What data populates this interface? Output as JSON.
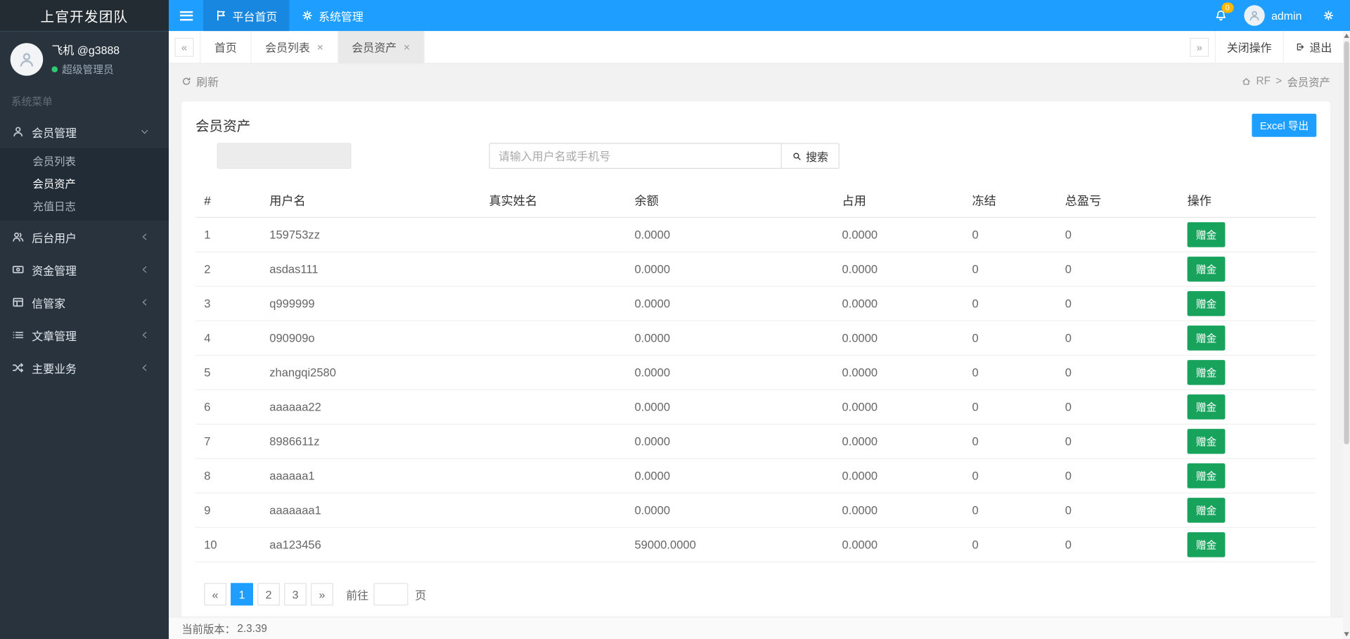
{
  "colors": {
    "navbar": "#1e9fff",
    "sidebar": "#28333e",
    "accent": "#1e9fff",
    "success_button": "#17a35c",
    "badge": "#ffb800"
  },
  "brand": {
    "title": "上官开发团队"
  },
  "topnav": {
    "menu": [
      {
        "label": "平台首页",
        "icon": "flag-icon"
      },
      {
        "label": "系统管理",
        "icon": "gear-icon"
      }
    ],
    "notification_count": "0",
    "username": "admin"
  },
  "sidebar": {
    "profile": {
      "name": "飞机 @g3888",
      "role": "超级管理员"
    },
    "section_label": "系统菜单",
    "menu": [
      {
        "label": "会员管理",
        "icon": "user-icon",
        "expanded": true,
        "children": [
          {
            "label": "会员列表"
          },
          {
            "label": "会员资产",
            "current": true
          },
          {
            "label": "充值日志"
          }
        ]
      },
      {
        "label": "后台用户",
        "icon": "users-icon"
      },
      {
        "label": "资金管理",
        "icon": "money-icon"
      },
      {
        "label": "信管家",
        "icon": "grid-icon"
      },
      {
        "label": "文章管理",
        "icon": "list-icon"
      },
      {
        "label": "主要业务",
        "icon": "shuffle-icon"
      }
    ]
  },
  "tabbar": {
    "scroll_left": "«",
    "scroll_right": "»",
    "close_glyph": "×",
    "tabs": [
      {
        "label": "首页",
        "closable": false
      },
      {
        "label": "会员列表",
        "closable": true
      },
      {
        "label": "会员资产",
        "closable": true,
        "active": true
      }
    ],
    "close_operations": "关闭操作",
    "logout": "退出"
  },
  "toolbar": {
    "refresh": "刷新",
    "breadcrumb": {
      "root": "RF",
      "separator": ">",
      "current": "会员资产"
    }
  },
  "content": {
    "title": "会员资产",
    "export_button": "Excel 导出",
    "search": {
      "placeholder": "请输入用户名或手机号",
      "button": "搜索"
    },
    "table": {
      "headers": [
        "#",
        "用户名",
        "真实姓名",
        "余额",
        "占用",
        "冻结",
        "总盈亏",
        "操作"
      ],
      "action_label": "赠金",
      "rows": [
        {
          "idx": "1",
          "username": "159753zz",
          "realname": "",
          "balance": "0.0000",
          "occupied": "0.0000",
          "frozen": "0",
          "profit": "0"
        },
        {
          "idx": "2",
          "username": "asdas111",
          "realname": "",
          "balance": "0.0000",
          "occupied": "0.0000",
          "frozen": "0",
          "profit": "0"
        },
        {
          "idx": "3",
          "username": "q999999",
          "realname": "",
          "balance": "0.0000",
          "occupied": "0.0000",
          "frozen": "0",
          "profit": "0"
        },
        {
          "idx": "4",
          "username": "090909o",
          "realname": "",
          "balance": "0.0000",
          "occupied": "0.0000",
          "frozen": "0",
          "profit": "0"
        },
        {
          "idx": "5",
          "username": "zhangqi2580",
          "realname": "",
          "balance": "0.0000",
          "occupied": "0.0000",
          "frozen": "0",
          "profit": "0"
        },
        {
          "idx": "6",
          "username": "aaaaaa22",
          "realname": "",
          "balance": "0.0000",
          "occupied": "0.0000",
          "frozen": "0",
          "profit": "0"
        },
        {
          "idx": "7",
          "username": "8986611z",
          "realname": "",
          "balance": "0.0000",
          "occupied": "0.0000",
          "frozen": "0",
          "profit": "0"
        },
        {
          "idx": "8",
          "username": "aaaaaa1",
          "realname": "",
          "balance": "0.0000",
          "occupied": "0.0000",
          "frozen": "0",
          "profit": "0"
        },
        {
          "idx": "9",
          "username": "aaaaaaa1",
          "realname": "",
          "balance": "0.0000",
          "occupied": "0.0000",
          "frozen": "0",
          "profit": "0"
        },
        {
          "idx": "10",
          "username": "aa123456",
          "realname": "",
          "balance": "59000.0000",
          "occupied": "0.0000",
          "frozen": "0",
          "profit": "0"
        }
      ]
    },
    "pagination": {
      "prev": "«",
      "next": "»",
      "pages": [
        "1",
        "2",
        "3"
      ],
      "active_page": "1",
      "goto_label": "前往",
      "unit_label": "页",
      "goto_value": ""
    }
  },
  "footer": {
    "label": "当前版本：",
    "version": "2.3.39"
  }
}
